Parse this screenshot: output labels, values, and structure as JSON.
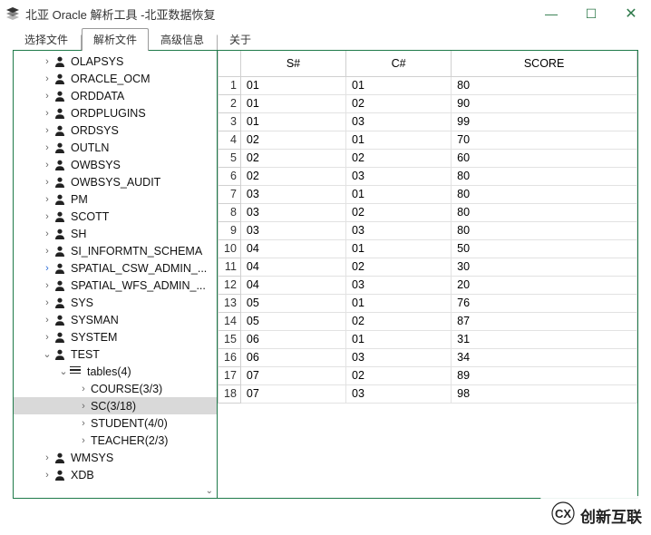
{
  "window": {
    "title": "北亚 Oracle 解析工具  -北亚数据恢复"
  },
  "tabs": [
    {
      "id": "select",
      "label": "选择文件",
      "active": false
    },
    {
      "id": "parse",
      "label": "解析文件",
      "active": true
    },
    {
      "id": "adv",
      "label": "高级信息",
      "active": false
    },
    {
      "id": "about",
      "label": "关于",
      "active": false
    }
  ],
  "tree": {
    "schemas": [
      {
        "label": "OLAPSYS"
      },
      {
        "label": "ORACLE_OCM"
      },
      {
        "label": "ORDDATA"
      },
      {
        "label": "ORDPLUGINS"
      },
      {
        "label": "ORDSYS"
      },
      {
        "label": "OUTLN"
      },
      {
        "label": "OWBSYS"
      },
      {
        "label": "OWBSYS_AUDIT"
      },
      {
        "label": "PM"
      },
      {
        "label": "SCOTT"
      },
      {
        "label": "SH"
      },
      {
        "label": "SI_INFORMTN_SCHEMA"
      },
      {
        "label": "SPATIAL_CSW_ADMIN_...",
        "highlight": true
      },
      {
        "label": "SPATIAL_WFS_ADMIN_..."
      },
      {
        "label": "SYS"
      },
      {
        "label": "SYSMAN"
      },
      {
        "label": "SYSTEM"
      },
      {
        "label": "TEST",
        "expanded": true,
        "children": {
          "label": "tables(4)",
          "expanded": true,
          "tables": [
            {
              "label": "COURSE(3/3)"
            },
            {
              "label": "SC(3/18)",
              "selected": true
            },
            {
              "label": "STUDENT(4/0)"
            },
            {
              "label": "TEACHER(2/3)"
            }
          ]
        }
      },
      {
        "label": "WMSYS"
      },
      {
        "label": "XDB"
      }
    ]
  },
  "grid": {
    "columns": [
      "S#",
      "C#",
      "SCORE"
    ],
    "rows": [
      {
        "n": "1",
        "S#": "01",
        "C#": "01",
        "SCORE": "80"
      },
      {
        "n": "2",
        "S#": "01",
        "C#": "02",
        "SCORE": "90"
      },
      {
        "n": "3",
        "S#": "01",
        "C#": "03",
        "SCORE": "99"
      },
      {
        "n": "4",
        "S#": "02",
        "C#": "01",
        "SCORE": "70"
      },
      {
        "n": "5",
        "S#": "02",
        "C#": "02",
        "SCORE": "60"
      },
      {
        "n": "6",
        "S#": "02",
        "C#": "03",
        "SCORE": "80"
      },
      {
        "n": "7",
        "S#": "03",
        "C#": "01",
        "SCORE": "80"
      },
      {
        "n": "8",
        "S#": "03",
        "C#": "02",
        "SCORE": "80"
      },
      {
        "n": "9",
        "S#": "03",
        "C#": "03",
        "SCORE": "80"
      },
      {
        "n": "10",
        "S#": "04",
        "C#": "01",
        "SCORE": "50"
      },
      {
        "n": "11",
        "S#": "04",
        "C#": "02",
        "SCORE": "30"
      },
      {
        "n": "12",
        "S#": "04",
        "C#": "03",
        "SCORE": "20"
      },
      {
        "n": "13",
        "S#": "05",
        "C#": "01",
        "SCORE": "76"
      },
      {
        "n": "14",
        "S#": "05",
        "C#": "02",
        "SCORE": "87"
      },
      {
        "n": "15",
        "S#": "06",
        "C#": "01",
        "SCORE": "31"
      },
      {
        "n": "16",
        "S#": "06",
        "C#": "03",
        "SCORE": "34"
      },
      {
        "n": "17",
        "S#": "07",
        "C#": "02",
        "SCORE": "89"
      },
      {
        "n": "18",
        "S#": "07",
        "C#": "03",
        "SCORE": "98"
      }
    ]
  },
  "watermark": {
    "text": "创新互联"
  }
}
